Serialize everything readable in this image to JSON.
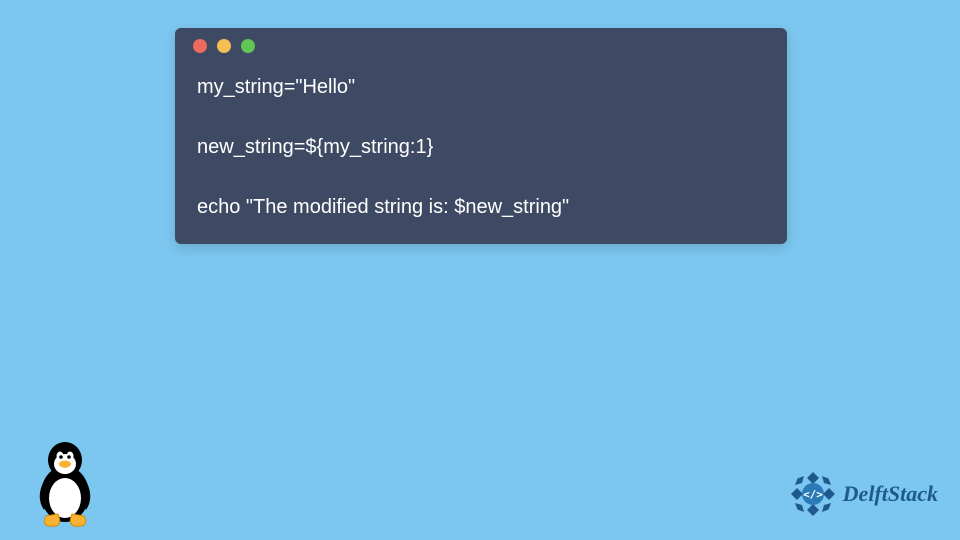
{
  "code": {
    "line1": "my_string=\"Hello\"",
    "line2": "new_string=${my_string:1}",
    "line3": "echo \"The modified string is: $new_string\""
  },
  "branding": {
    "name": "DelftStack"
  },
  "colors": {
    "background": "#7cc7f0",
    "window": "#3e4a63",
    "dot_red": "#ed6a5e",
    "dot_yellow": "#f4bf50",
    "dot_green": "#62c655"
  }
}
